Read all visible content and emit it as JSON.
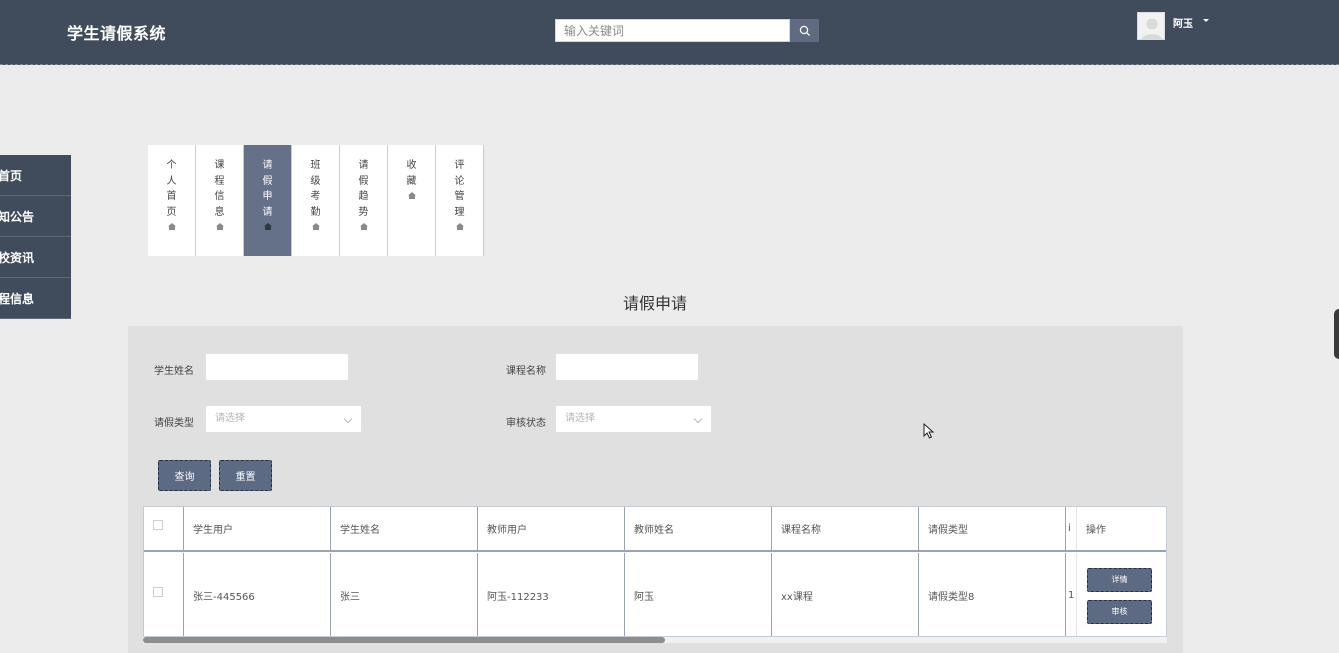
{
  "header": {
    "title": "学生请假系统",
    "search_placeholder": "输入关键词",
    "user_name": "阿玉"
  },
  "sidebar": {
    "items": [
      {
        "label": "首页"
      },
      {
        "label": "知公告"
      },
      {
        "label": "校资讯"
      },
      {
        "label": "程信息"
      }
    ]
  },
  "tabs": [
    {
      "label": "个人首页",
      "icon": "home-icon"
    },
    {
      "label": "课程信息",
      "icon": "home-icon"
    },
    {
      "label": "请假申请",
      "icon": "home-icon",
      "active": true
    },
    {
      "label": "班级考勤",
      "icon": "home-icon"
    },
    {
      "label": "请假趋势",
      "icon": "home-icon"
    },
    {
      "label": "收藏",
      "icon": "home-icon"
    },
    {
      "label": "评论管理",
      "icon": "home-icon"
    }
  ],
  "page_title": "请假申请",
  "form": {
    "student_name_label": "学生姓名",
    "course_name_label": "课程名称",
    "leave_type_label": "请假类型",
    "leave_type_placeholder": "请选择",
    "review_status_label": "审核状态",
    "review_status_placeholder": "请选择",
    "search_button": "查询",
    "reset_button": "重置"
  },
  "table": {
    "columns": [
      "学生用户",
      "学生姓名",
      "教师用户",
      "教师姓名",
      "课程名称",
      "请假类型",
      "i",
      "操作"
    ],
    "rows": [
      {
        "student_user": "张三-445566",
        "student_name": "张三",
        "teacher_user": "阿玉-112233",
        "teacher_name": "阿玉",
        "course_name": "xx课程",
        "leave_type": "请假类型8",
        "hidden": "1",
        "detail_button": "详情",
        "review_button": "审核"
      }
    ]
  },
  "colors": {
    "header_bg": "#404b5c",
    "accent": "#647189",
    "button_bg": "#5d6a84",
    "page_bg": "#ececec"
  }
}
